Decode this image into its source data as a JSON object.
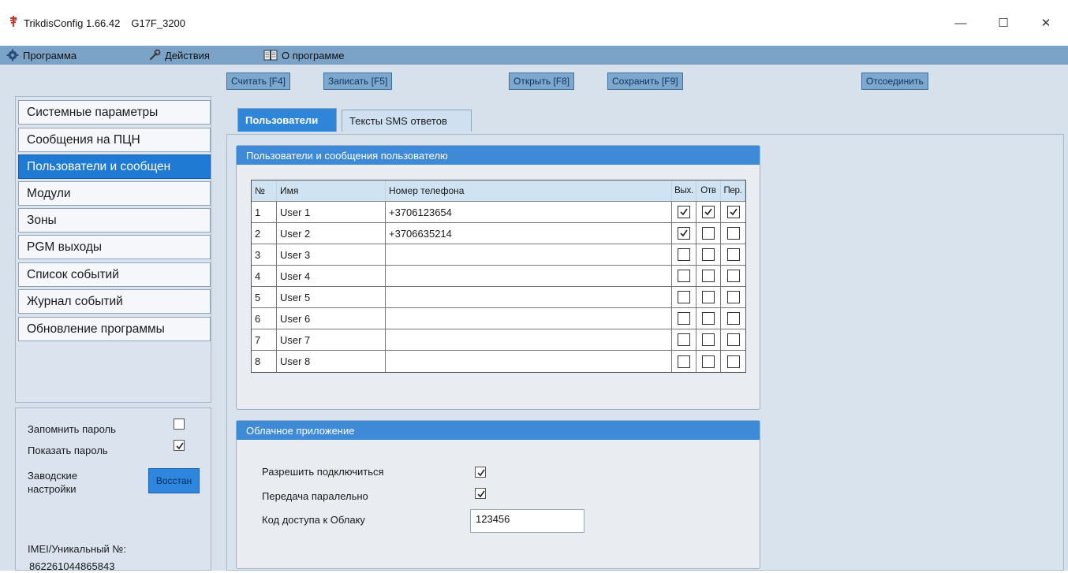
{
  "window": {
    "app_name": "TrikdisConfig 1.66.42",
    "device": "G17F_3200",
    "minimize": "—",
    "maximize": "☐",
    "close": "✕"
  },
  "menu": [
    {
      "label": "Программа",
      "icon": "gear-icon"
    },
    {
      "label": "Действия",
      "icon": "wrench-icon"
    },
    {
      "label": "О программе",
      "icon": "book-icon"
    }
  ],
  "toolbar": {
    "read": "Считать [F4]",
    "write": "Записать [F5]",
    "open": "Открыть [F8]",
    "save": "Сохранить [F9]",
    "disconnect": "Отсоединить"
  },
  "sidebar": {
    "items": [
      {
        "label": "Системные параметры",
        "active": false
      },
      {
        "label": "Сообщения на ПЦН",
        "active": false
      },
      {
        "label": "Пользователи и сообщен",
        "active": true
      },
      {
        "label": "Модули",
        "active": false
      },
      {
        "label": "Зоны",
        "active": false
      },
      {
        "label": "PGM выходы",
        "active": false
      },
      {
        "label": "Список событий",
        "active": false
      },
      {
        "label": "Журнал событий",
        "active": false
      },
      {
        "label": "Обновление программы",
        "active": false
      }
    ]
  },
  "settings": {
    "remember_password": {
      "label": "Запомнить пароль",
      "checked": false
    },
    "show_password": {
      "label": "Показать пароль",
      "checked": true
    },
    "factory_line1": "Заводские",
    "factory_line2": "настройки",
    "restore_button": "Восстан",
    "imei_label": "IMEI/Уникальный №:",
    "imei_value": "862261044865843"
  },
  "tabs": [
    {
      "label": "Пользователи",
      "active": true
    },
    {
      "label": "Тексты SMS ответов",
      "active": false
    }
  ],
  "users_group": {
    "title": "Пользователи и сообщения пользователю",
    "columns": [
      "№",
      "Имя",
      "Номер телефона",
      "Вых.",
      "Отв",
      "Пер."
    ],
    "rows": [
      {
        "no": "1",
        "name": "User 1",
        "phone": "+3706123654",
        "out": true,
        "ans": true,
        "fwd": true
      },
      {
        "no": "2",
        "name": "User 2",
        "phone": "+3706635214",
        "out": true,
        "ans": false,
        "fwd": false
      },
      {
        "no": "3",
        "name": "User 3",
        "phone": "",
        "out": false,
        "ans": false,
        "fwd": false
      },
      {
        "no": "4",
        "name": "User 4",
        "phone": "",
        "out": false,
        "ans": false,
        "fwd": false
      },
      {
        "no": "5",
        "name": "User 5",
        "phone": "",
        "out": false,
        "ans": false,
        "fwd": false
      },
      {
        "no": "6",
        "name": "User 6",
        "phone": "",
        "out": false,
        "ans": false,
        "fwd": false
      },
      {
        "no": "7",
        "name": "User 7",
        "phone": "",
        "out": false,
        "ans": false,
        "fwd": false
      },
      {
        "no": "8",
        "name": "User 8",
        "phone": "",
        "out": false,
        "ans": false,
        "fwd": false
      }
    ]
  },
  "cloud_group": {
    "title": "Облачное приложение",
    "allow_connect": {
      "label": "Разрешить подключиться",
      "checked": true
    },
    "parallel": {
      "label": "Передача паралельно",
      "checked": true
    },
    "access_code": {
      "label": "Код доступа к Облаку",
      "value": "123456"
    }
  },
  "colors": {
    "menubar": "#7aa3c7",
    "accent": "#1f7ad4",
    "group_header": "#3e8ad6",
    "workspace": "#d7e1ec"
  }
}
